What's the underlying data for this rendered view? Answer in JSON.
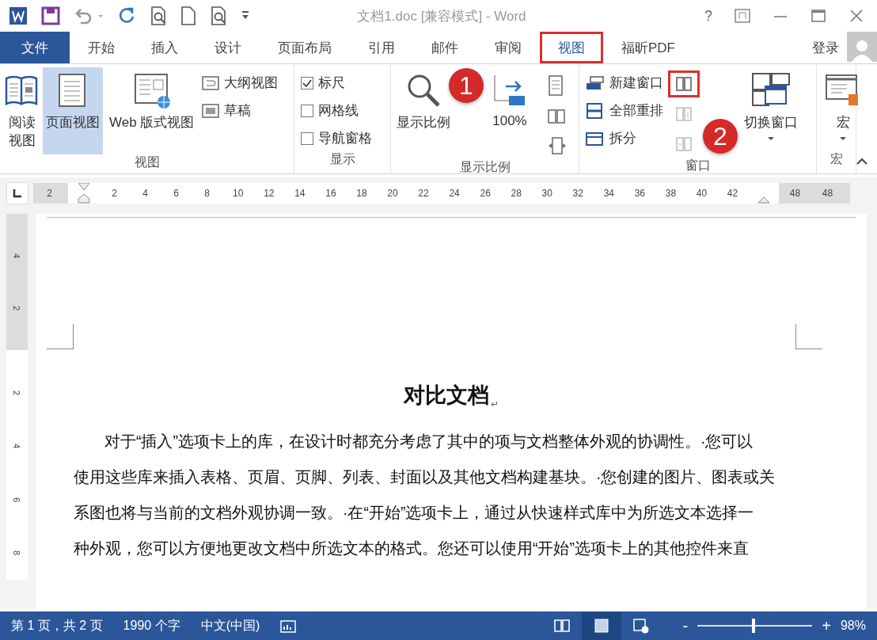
{
  "window": {
    "title": "文档1.doc [兼容模式] - Word",
    "help": "?"
  },
  "tabs": [
    {
      "label": "文件",
      "kind": "file",
      "selected": false,
      "highlighted": false
    },
    {
      "label": "开始",
      "kind": "tab",
      "selected": false,
      "highlighted": false
    },
    {
      "label": "插入",
      "kind": "tab",
      "selected": false,
      "highlighted": false
    },
    {
      "label": "设计",
      "kind": "tab",
      "selected": false,
      "highlighted": false
    },
    {
      "label": "页面布局",
      "kind": "tab",
      "selected": false,
      "highlighted": false
    },
    {
      "label": "引用",
      "kind": "tab",
      "selected": false,
      "highlighted": false
    },
    {
      "label": "邮件",
      "kind": "tab",
      "selected": false,
      "highlighted": false
    },
    {
      "label": "审阅",
      "kind": "tab",
      "selected": false,
      "highlighted": false
    },
    {
      "label": "视图",
      "kind": "tab",
      "selected": true,
      "highlighted": true
    },
    {
      "label": "福昕PDF",
      "kind": "tab",
      "selected": false,
      "highlighted": false
    }
  ],
  "account": {
    "label": "登录"
  },
  "ribbon": {
    "groups": [
      {
        "kind": "views",
        "label": "视图",
        "large": [
          {
            "label": "阅读视图",
            "selected": false
          },
          {
            "label": "页面视图",
            "selected": true
          },
          {
            "label": "Web 版式视图",
            "selected": false
          }
        ],
        "small": [
          "大纲视图",
          "草稿"
        ]
      },
      {
        "kind": "show",
        "label": "显示",
        "options": [
          {
            "label": "标尺",
            "checked": true
          },
          {
            "label": "网格线",
            "checked": false
          },
          {
            "label": "导航窗格",
            "checked": false
          }
        ]
      },
      {
        "kind": "zoom",
        "label": "显示比例",
        "buttons": [
          "显示比例",
          "100%"
        ]
      },
      {
        "kind": "window",
        "label": "窗口",
        "commands": [
          "新建窗口",
          "全部重排",
          "拆分"
        ],
        "side_buttons": [
          {
            "highlighted": true,
            "disabled": false
          },
          {
            "highlighted": false,
            "disabled": true
          },
          {
            "highlighted": false,
            "disabled": true
          }
        ],
        "switch": "切换窗口"
      },
      {
        "kind": "macro",
        "label": "宏",
        "button": "宏"
      }
    ]
  },
  "annotations": [
    {
      "number": "1"
    },
    {
      "number": "2"
    }
  ],
  "ruler": {
    "left_margin_labels": [
      "2"
    ],
    "labels": [
      "2",
      "4",
      "6",
      "8",
      "10",
      "12",
      "14",
      "16",
      "18",
      "20",
      "22",
      "24",
      "26",
      "28",
      "30",
      "32",
      "34",
      "36",
      "38",
      "40",
      "42"
    ],
    "right_margin_labels": [
      "48",
      "48"
    ]
  },
  "vertical_ruler": {
    "top_margin_labels": [
      "4",
      "2"
    ],
    "labels": [
      "2",
      "4",
      "6",
      "8"
    ]
  },
  "document": {
    "title": "对比文档",
    "title_mark": "↵",
    "paragraph_lines": [
      "对于“插入”选项卡上的库，在设计时都充分考虑了其中的项与文档整体外观的协调性。·您可以",
      "使用这些库来插入表格、页眉、页脚、列表、封面以及其他文档构建基块。·您创建的图片、图表或关",
      "系图也将与当前的文档外观协调一致。·在“开始”选项卡上，通过从快速样式库中为所选文本选择一",
      "种外观，您可以方便地更改文档中所选文本的格式。您还可以使用“开始”选项卡上的其他控件来直"
    ]
  },
  "status_bar": {
    "page": "第 1 页，共 2 页",
    "words": "1990 个字",
    "language": "中文(中国)",
    "view_buttons": [
      {
        "selected": false
      },
      {
        "selected": true
      },
      {
        "selected": false
      }
    ],
    "zoom": {
      "minus": "-",
      "plus": "+",
      "level": 0.49,
      "reading": "98%"
    }
  }
}
